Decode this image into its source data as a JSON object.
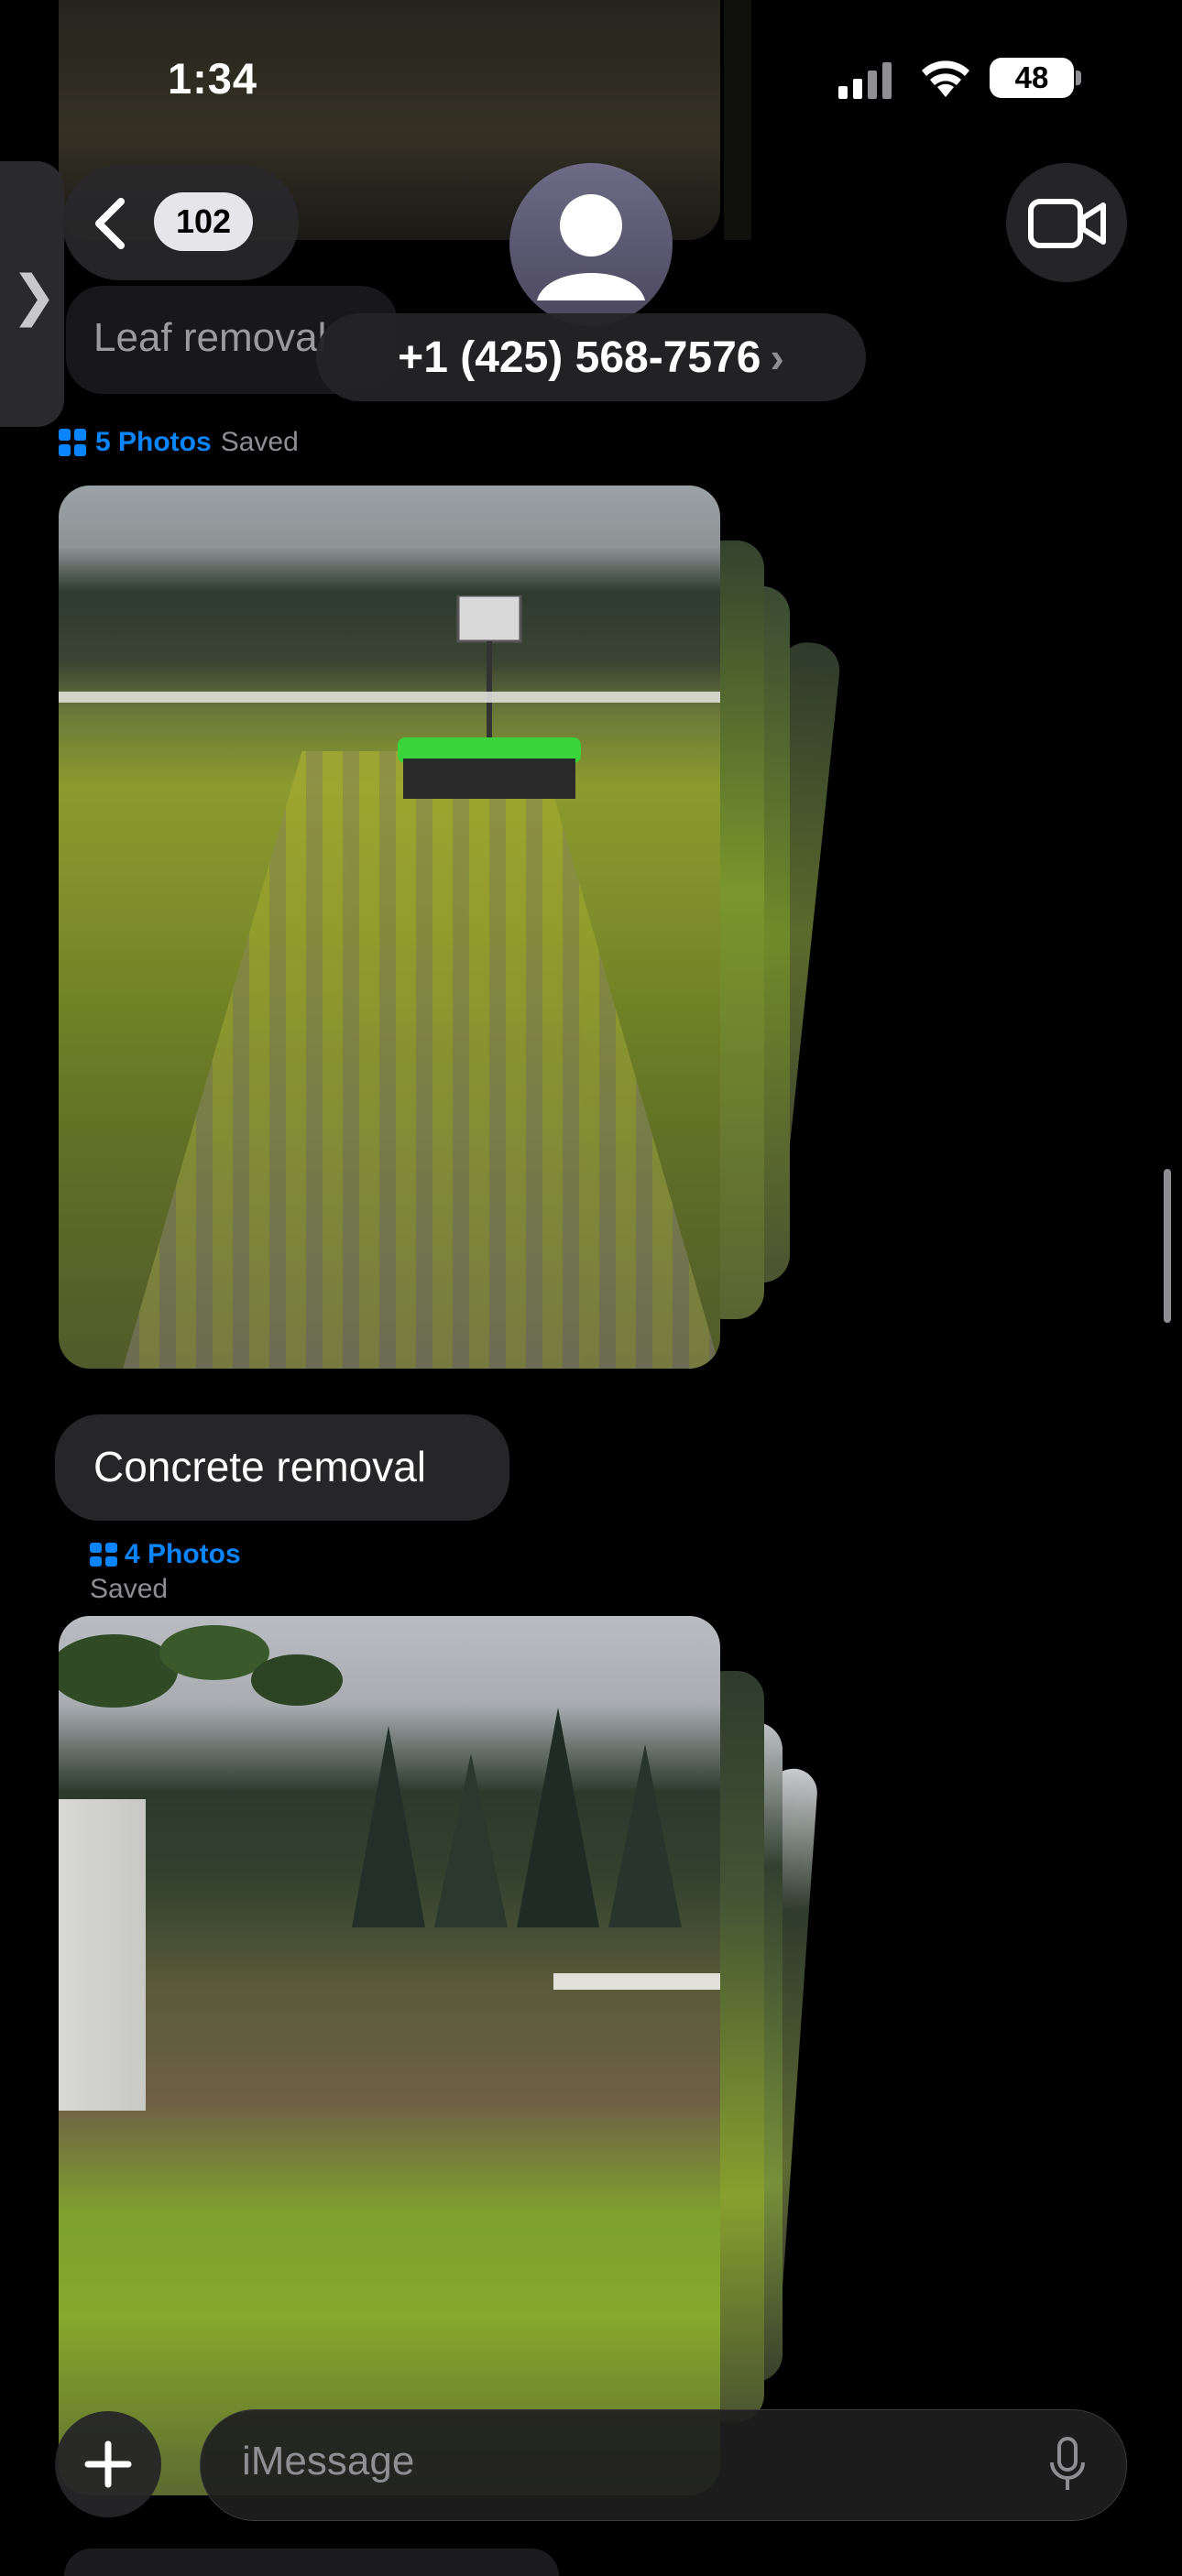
{
  "status_bar": {
    "time": "1:34",
    "battery": "48"
  },
  "nav": {
    "back_count": "102",
    "contact": "+1 (425) 568-7576",
    "chevron": "›",
    "side_tab_chevron": "❯"
  },
  "messages": [
    {
      "type": "text",
      "text": "Leaf removal"
    },
    {
      "type": "photos",
      "count_label": "5 Photos",
      "status": "Saved"
    },
    {
      "type": "text",
      "text": "Concrete removal"
    },
    {
      "type": "photos",
      "count_label": "4 Photos",
      "status": "Saved"
    }
  ],
  "composer": {
    "placeholder": "iMessage"
  },
  "colors": {
    "accent": "#0a84ff",
    "bubble": "#262628",
    "background": "#000000"
  }
}
